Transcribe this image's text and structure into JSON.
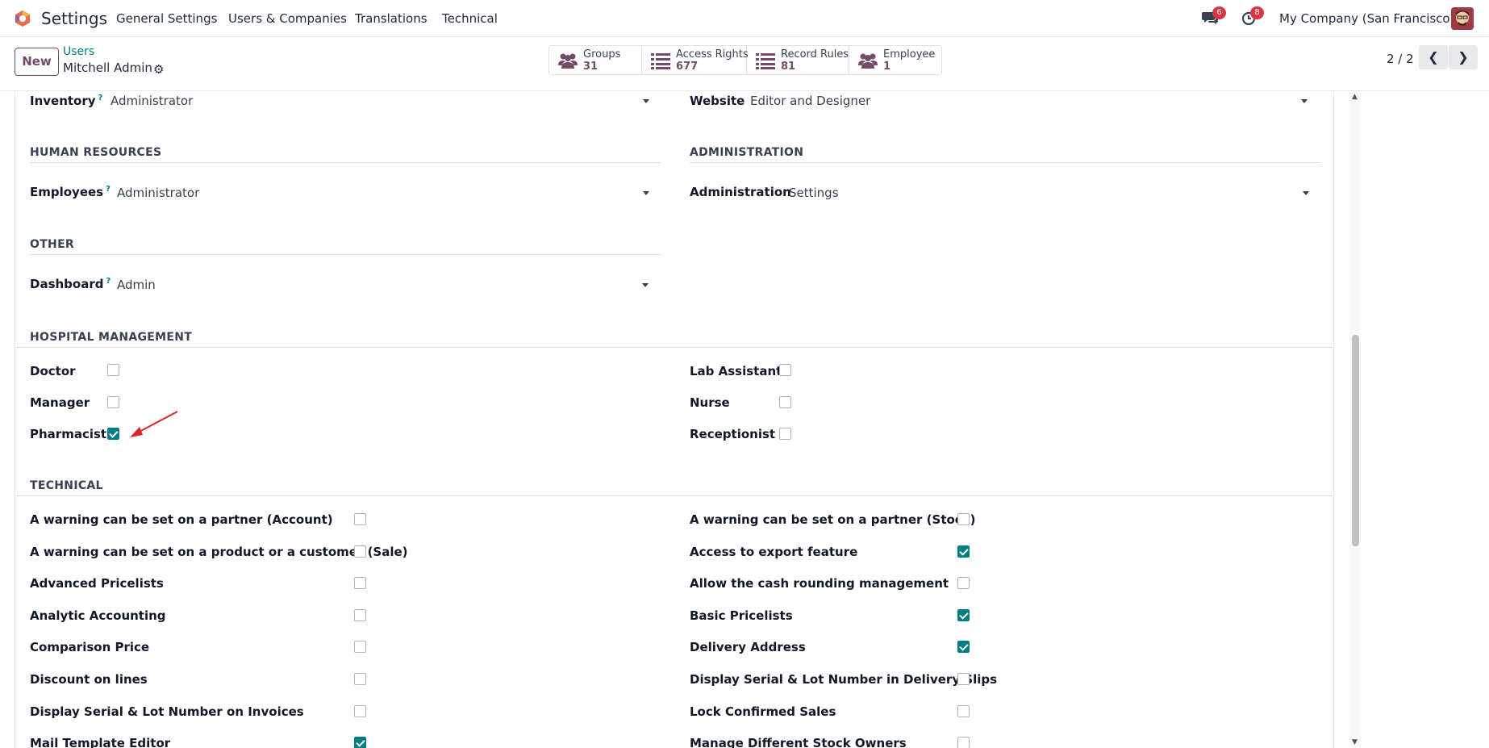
{
  "navbar": {
    "app_title": "Settings",
    "menus": [
      "General Settings",
      "Users & Companies",
      "Translations",
      "Technical"
    ],
    "messages_count": "6",
    "activities_count": "8",
    "company": "My Company (San Francisco)"
  },
  "control": {
    "new_label": "New",
    "breadcrumb_parent": "Users",
    "breadcrumb_current": "Mitchell Admin",
    "smart_buttons": [
      {
        "label": "Groups",
        "count": "31",
        "icon": "users-icon"
      },
      {
        "label": "Access Rights",
        "count": "677",
        "icon": "list-icon"
      },
      {
        "label": "Record Rules",
        "count": "81",
        "icon": "list-icon"
      },
      {
        "label": "Employee",
        "count": "1",
        "icon": "users-icon"
      }
    ],
    "pager": "2 / 2"
  },
  "fields": {
    "inventory": {
      "label": "Inventory",
      "help": "?",
      "value": "Administrator"
    },
    "website": {
      "label": "Website",
      "value": "Editor and Designer"
    },
    "employees": {
      "label": "Employees",
      "help": "?",
      "value": "Administrator"
    },
    "administration": {
      "label": "Administration",
      "value": "Settings"
    },
    "dashboard": {
      "label": "Dashboard",
      "help": "?",
      "value": "Admin"
    }
  },
  "sections": {
    "human_resources": "HUMAN RESOURCES",
    "administration": "ADMINISTRATION",
    "other": "OTHER",
    "hospital": "HOSPITAL MANAGEMENT",
    "technical": "TECHNICAL"
  },
  "hospital": [
    {
      "label": "Doctor",
      "checked": false
    },
    {
      "label": "Lab Assistant",
      "checked": false
    },
    {
      "label": "Manager",
      "checked": false
    },
    {
      "label": "Nurse",
      "checked": false
    },
    {
      "label": "Pharmacist",
      "checked": true
    },
    {
      "label": "Receptionist",
      "checked": false
    }
  ],
  "technical_left": [
    {
      "label": "A warning can be set on a partner (Account)",
      "checked": false
    },
    {
      "label": "A warning can be set on a product or a customer (Sale)",
      "checked": false
    },
    {
      "label": "Advanced Pricelists",
      "checked": false
    },
    {
      "label": "Analytic Accounting",
      "checked": false
    },
    {
      "label": "Comparison Price",
      "checked": false
    },
    {
      "label": "Discount on lines",
      "checked": false
    },
    {
      "label": "Display Serial & Lot Number on Invoices",
      "checked": false
    },
    {
      "label": "Mail Template Editor",
      "checked": true
    }
  ],
  "technical_right": [
    {
      "label": "A warning can be set on a partner (Stock)",
      "checked": false
    },
    {
      "label": "Access to export feature",
      "checked": true
    },
    {
      "label": "Allow the cash rounding management",
      "checked": false
    },
    {
      "label": "Basic Pricelists",
      "checked": true
    },
    {
      "label": "Delivery Address",
      "checked": true
    },
    {
      "label": "Display Serial & Lot Number in Delivery Slips",
      "checked": false
    },
    {
      "label": "Lock Confirmed Sales",
      "checked": false
    },
    {
      "label": "Manage Different Stock Owners",
      "checked": false
    }
  ],
  "colors": {
    "brand": "#714b67",
    "accent": "#017e84",
    "badge": "#dc3545",
    "annotation": "#e02424"
  }
}
